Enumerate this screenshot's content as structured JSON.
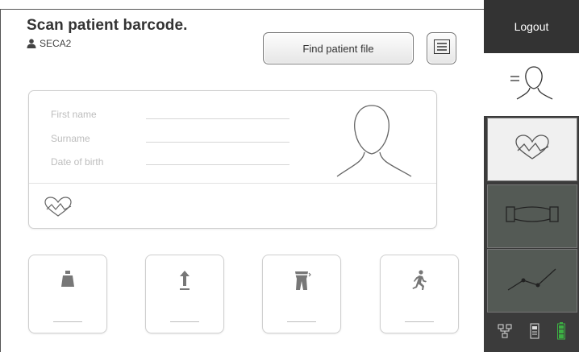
{
  "header": {
    "title": "Scan patient barcode.",
    "user_name": "SECA2",
    "find_button_label": "Find patient file"
  },
  "patient_fields": {
    "first_name_label": "First name",
    "surname_label": "Surname",
    "dob_label": "Date of birth"
  },
  "tiles": [
    {
      "icon": "weight-icon",
      "value": ""
    },
    {
      "icon": "height-icon",
      "value": ""
    },
    {
      "icon": "body-measure-icon",
      "value": ""
    },
    {
      "icon": "activity-icon",
      "value": ""
    }
  ],
  "sidebar": {
    "logout_label": "Logout",
    "items": [
      {
        "icon": "patient-list-icon"
      },
      {
        "icon": "heart-rate-icon"
      },
      {
        "icon": "bioimpedance-icon"
      },
      {
        "icon": "trend-chart-icon"
      }
    ],
    "status_icons": [
      "network-icon",
      "device-icon",
      "battery-icon"
    ]
  },
  "colors": {
    "sidebar_bg": "#3b3b3b",
    "sidebar_inactive": "#545a55",
    "battery_green": "#3cb043"
  }
}
